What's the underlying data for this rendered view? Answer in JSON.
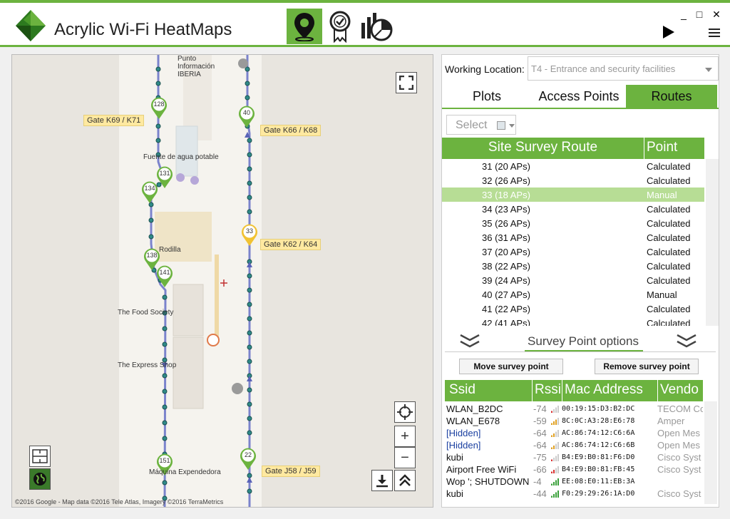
{
  "app": {
    "title": "Acrylic Wi-Fi HeatMaps"
  },
  "window": {
    "minimize": "_",
    "maximize": "□",
    "close": "✕"
  },
  "toolbar": {
    "icons": [
      "map-pin-icon",
      "certificate-icon",
      "reports-icon"
    ],
    "brand_color": "#6cb33f"
  },
  "map": {
    "gates": [
      "Gate K69 / K71",
      "Gate K66 / K68",
      "Gate K62 / K64",
      "Gate J58 / J59"
    ],
    "pois": [
      "Punto Información IBERIA",
      "Fuente de agua potable",
      "Rodilla",
      "The Food Society",
      "The Express Shop",
      "Máquina Expendedora"
    ],
    "markers_green": [
      "128",
      "131",
      "134",
      "138",
      "141",
      "151",
      "40",
      "22"
    ],
    "markers_yellow": [
      "33"
    ],
    "credit": "©2016 Google - Map data ©2016 Tele Atlas, Imagery ©2016 TerraMetrics"
  },
  "panel": {
    "working_location_label": "Working Location:",
    "working_location_value": "T4 - Entrance and security facilities",
    "tabs": [
      "Plots",
      "Access Points",
      "Routes"
    ],
    "active_tab": "Routes",
    "select_placeholder": "Select",
    "route_table": {
      "headers": [
        "Site Survey Route",
        "Point"
      ],
      "rows": [
        [
          "31 (20 APs)",
          "Calculated"
        ],
        [
          "32 (26 APs)",
          "Calculated"
        ],
        [
          "33 (18 APs)",
          "Manual"
        ],
        [
          "34 (23 APs)",
          "Calculated"
        ],
        [
          "35 (26 APs)",
          "Calculated"
        ],
        [
          "36 (31 APs)",
          "Calculated"
        ],
        [
          "37 (20 APs)",
          "Calculated"
        ],
        [
          "38 (22 APs)",
          "Calculated"
        ],
        [
          "39 (24 APs)",
          "Calculated"
        ],
        [
          "40 (27 APs)",
          "Manual"
        ],
        [
          "41 (22 APs)",
          "Calculated"
        ],
        [
          "42 (41 APs)",
          "Calculated"
        ]
      ],
      "selected_index": 2
    },
    "survey_options_title": "Survey Point options",
    "move_button": "Move survey point",
    "remove_button": "Remove survey point",
    "ap_table": {
      "headers": [
        "Ssid",
        "Rssi",
        "Mac Address",
        "Vendo"
      ],
      "rows": [
        {
          "ssid": "WLAN_B2DC",
          "rssi": "-74",
          "mac": "00:19:15:D3:B2:DC",
          "vendor": "TECOM Co",
          "hidden": false,
          "bars": 1,
          "bar_color": "#d93030"
        },
        {
          "ssid": "WLAN_E678",
          "rssi": "-59",
          "mac": "8C:0C:A3:28:E6:78",
          "vendor": "Amper",
          "hidden": false,
          "bars": 3,
          "bar_color": "#e0a020"
        },
        {
          "ssid": "[Hidden]",
          "rssi": "-64",
          "mac": "AC:86:74:12:C6:6A",
          "vendor": "Open Mes",
          "hidden": true,
          "bars": 2,
          "bar_color": "#e0a020"
        },
        {
          "ssid": "[Hidden]",
          "rssi": "-64",
          "mac": "AC:86:74:12:C6:6B",
          "vendor": "Open Mes",
          "hidden": true,
          "bars": 2,
          "bar_color": "#e0a020"
        },
        {
          "ssid": "kubi",
          "rssi": "-75",
          "mac": "B4:E9:B0:81:F6:D0",
          "vendor": "Cisco Syst",
          "hidden": false,
          "bars": 1,
          "bar_color": "#d93030"
        },
        {
          "ssid": "Airport Free WiFi",
          "rssi": "-66",
          "mac": "B4:E9:B0:81:FB:45",
          "vendor": "Cisco Syst",
          "hidden": false,
          "bars": 2,
          "bar_color": "#d93030"
        },
        {
          "ssid": "Wop '; SHUTDOWN",
          "rssi": "-4",
          "mac": "EE:08:E0:11:EB:3A",
          "vendor": "",
          "hidden": false,
          "bars": 4,
          "bar_color": "#3aa03a"
        },
        {
          "ssid": "kubi",
          "rssi": "-44",
          "mac": "F0:29:29:26:1A:D0",
          "vendor": "Cisco Syst",
          "hidden": false,
          "bars": 4,
          "bar_color": "#3aa03a"
        }
      ]
    }
  }
}
